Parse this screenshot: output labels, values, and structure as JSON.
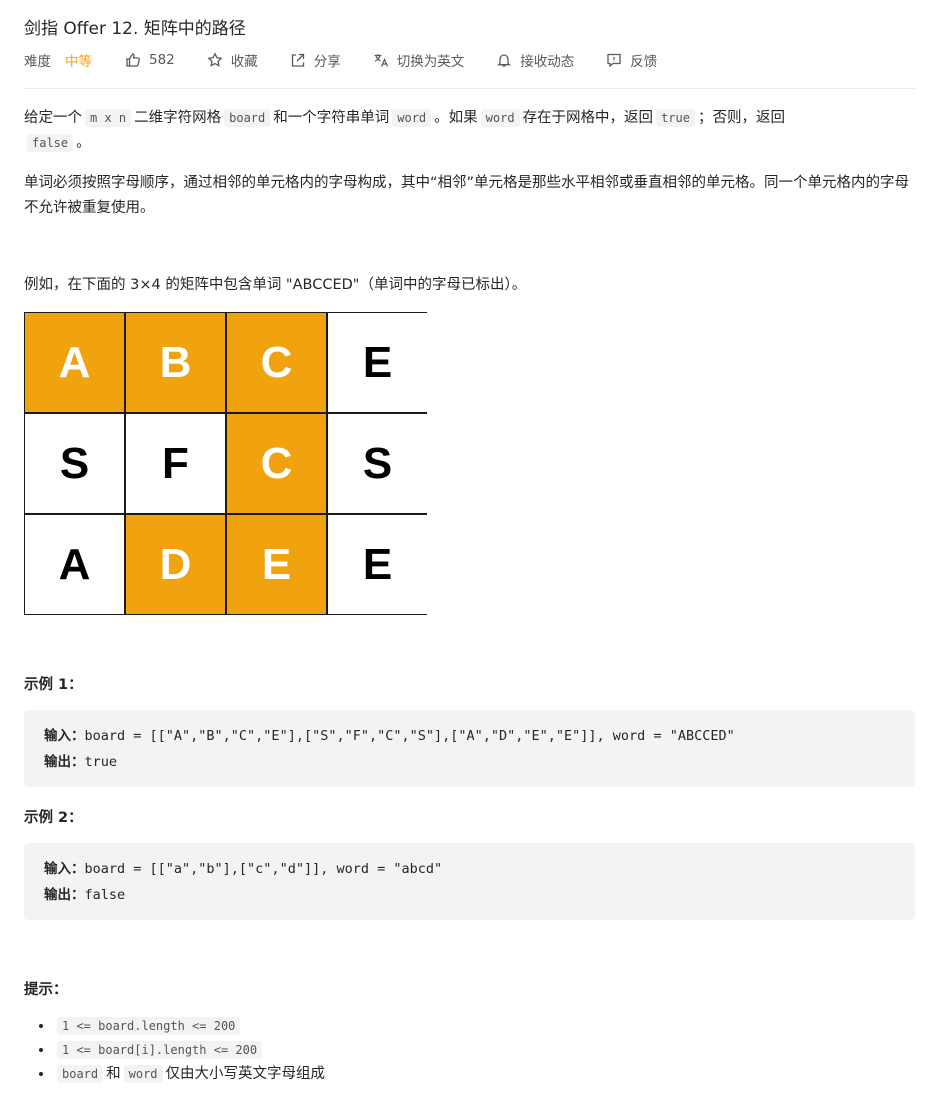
{
  "title": "剑指 Offer 12. 矩阵中的路径",
  "meta": {
    "difficulty_label": "难度",
    "difficulty_value": "中等",
    "likes": "582",
    "favorite": "收藏",
    "share": "分享",
    "translate": "切换为英文",
    "subscribe": "接收动态",
    "feedback": "反馈"
  },
  "colors": {
    "difficulty": "#ffa116",
    "highlight": "#f0a30f",
    "code_bg": "#f2f3f5"
  },
  "description": {
    "p1": [
      "给定一个",
      "m x n",
      "二维字符网格",
      "board",
      "和一个字符串单词",
      "word",
      "。如果",
      "word",
      "存在于网格中，返回",
      "true",
      "；否则，返回",
      "false",
      "。"
    ],
    "p2": "单词必须按照字母顺序，通过相邻的单元格内的字母构成，其中“相邻”单元格是那些水平相邻或垂直相邻的单元格。同一个单元格内的字母不允许被重复使用。",
    "p3": "例如，在下面的 3×4 的矩阵中包含单词 \"ABCCED\"（单词中的字母已标出）。"
  },
  "grid": [
    [
      {
        "letter": "A",
        "highlight": true
      },
      {
        "letter": "B",
        "highlight": true
      },
      {
        "letter": "C",
        "highlight": true
      },
      {
        "letter": "E",
        "highlight": false
      }
    ],
    [
      {
        "letter": "S",
        "highlight": false
      },
      {
        "letter": "F",
        "highlight": false
      },
      {
        "letter": "C",
        "highlight": true
      },
      {
        "letter": "S",
        "highlight": false
      }
    ],
    [
      {
        "letter": "A",
        "highlight": false
      },
      {
        "letter": "D",
        "highlight": true
      },
      {
        "letter": "E",
        "highlight": true
      },
      {
        "letter": "E",
        "highlight": false
      }
    ]
  ],
  "examples": [
    {
      "title": "示例 1：",
      "input_label": "输入：",
      "input": "board = [[\"A\",\"B\",\"C\",\"E\"],[\"S\",\"F\",\"C\",\"S\"],[\"A\",\"D\",\"E\",\"E\"]], word = \"ABCCED\"",
      "output_label": "输出：",
      "output": "true"
    },
    {
      "title": "示例 2：",
      "input_label": "输入：",
      "input": "board = [[\"a\",\"b\"],[\"c\",\"d\"]], word = \"abcd\"",
      "output_label": "输出：",
      "output": "false"
    }
  ],
  "hints": {
    "title": "提示：",
    "items": [
      {
        "code": "1 <= board.length <= 200"
      },
      {
        "code": "1 <= board[i].length <= 200"
      },
      {
        "code": "board",
        "text1": "和",
        "code2": "word",
        "text2": "仅由大小写英文字母组成"
      }
    ]
  }
}
